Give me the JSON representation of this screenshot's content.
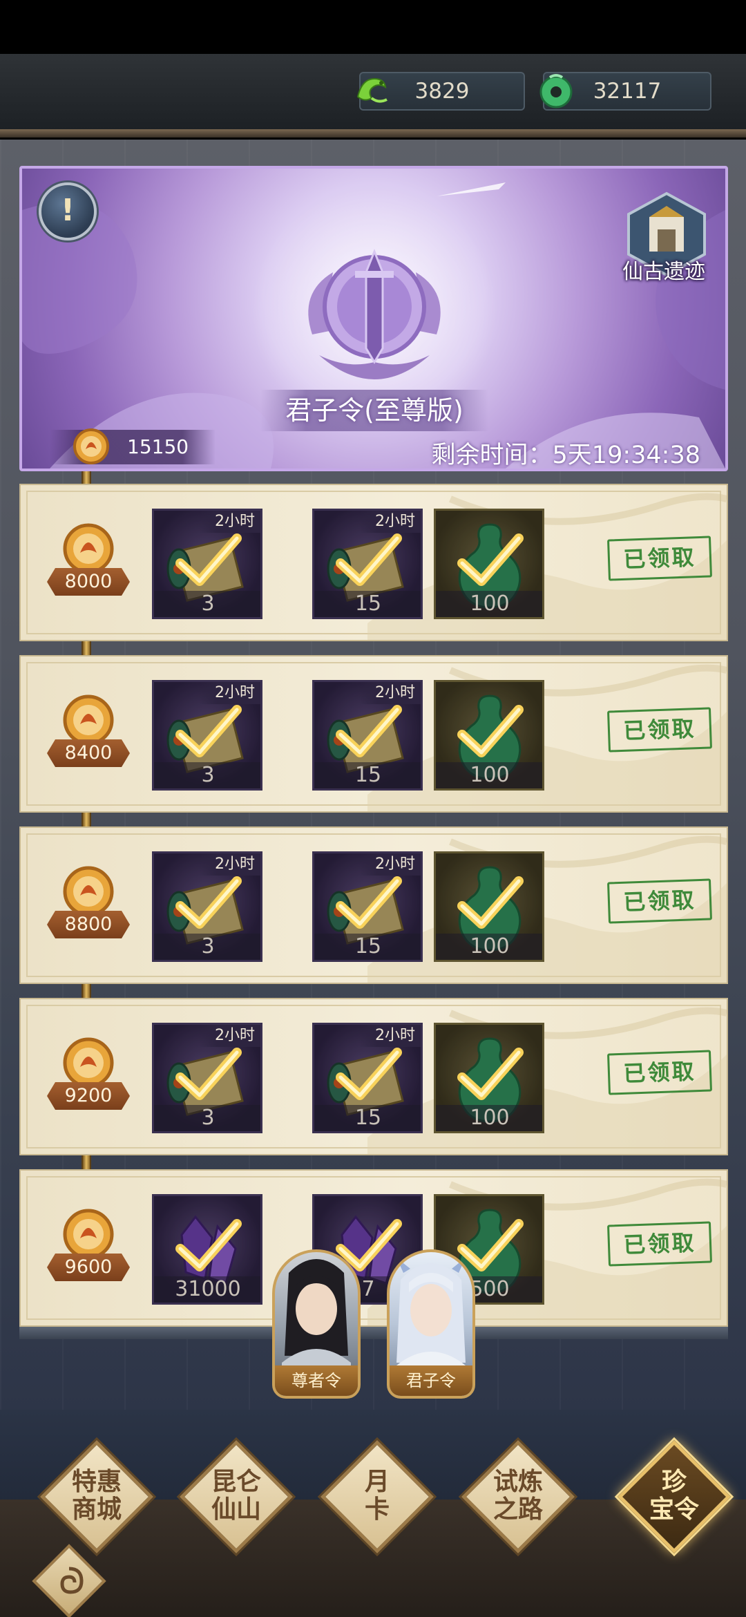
{
  "currency": {
    "dragon_jade": {
      "icon": "dragon-jade-icon",
      "value": "3829"
    },
    "jade_coin": {
      "icon": "jade-coin-icon",
      "value": "32117"
    }
  },
  "banner": {
    "title": "君子令(至尊版)",
    "side_label": "仙古遗迹",
    "points": {
      "icon": "gold-token-icon",
      "value": "15150"
    },
    "timer": "剩余时间：5天19:34:38",
    "info_icon": "!"
  },
  "rows": [
    {
      "milestone": "8000",
      "items": [
        {
          "type": "scroll",
          "duration": "2小时",
          "qty": "3"
        },
        {
          "type": "scroll",
          "duration": "2小时",
          "qty": "15"
        },
        {
          "type": "jade-gourd",
          "duration": "",
          "qty": "100"
        }
      ],
      "status": "已领取"
    },
    {
      "milestone": "8400",
      "items": [
        {
          "type": "scroll",
          "duration": "2小时",
          "qty": "3"
        },
        {
          "type": "scroll",
          "duration": "2小时",
          "qty": "15"
        },
        {
          "type": "jade-gourd",
          "duration": "",
          "qty": "100"
        }
      ],
      "status": "已领取"
    },
    {
      "milestone": "8800",
      "items": [
        {
          "type": "scroll",
          "duration": "2小时",
          "qty": "3"
        },
        {
          "type": "scroll",
          "duration": "2小时",
          "qty": "15"
        },
        {
          "type": "jade-gourd",
          "duration": "",
          "qty": "100"
        }
      ],
      "status": "已领取"
    },
    {
      "milestone": "9200",
      "items": [
        {
          "type": "scroll",
          "duration": "2小时",
          "qty": "3"
        },
        {
          "type": "scroll",
          "duration": "2小时",
          "qty": "15"
        },
        {
          "type": "jade-gourd",
          "duration": "",
          "qty": "100"
        }
      ],
      "status": "已领取"
    },
    {
      "milestone": "9600",
      "items": [
        {
          "type": "crystal",
          "duration": "",
          "qty": "31000"
        },
        {
          "type": "crystal",
          "duration": "",
          "qty": "7"
        },
        {
          "type": "jade-gourd",
          "duration": "",
          "qty": "500"
        }
      ],
      "status": "已领取"
    }
  ],
  "pass_cards": [
    {
      "label": "尊者令"
    },
    {
      "label": "君子令"
    }
  ],
  "nav": [
    {
      "label_1": "特惠",
      "label_2": "商城"
    },
    {
      "label_1": "昆仑",
      "label_2": "仙山"
    },
    {
      "label_1": "月",
      "label_2": "卡"
    },
    {
      "label_1": "试炼",
      "label_2": "之路"
    },
    {
      "label_1": "珍",
      "label_2": "宝令",
      "active": true
    }
  ],
  "colors": {
    "banner_purple": "#b89ad9",
    "claimed_green": "#3f8a3a",
    "track_gold": "#e2bb62"
  }
}
